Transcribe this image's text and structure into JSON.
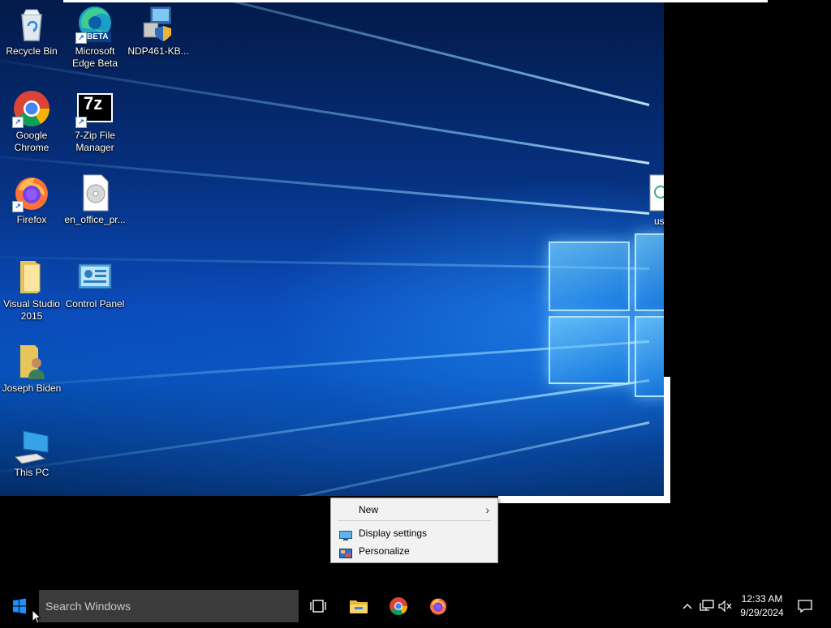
{
  "desktop": {
    "icons": [
      {
        "label": "Recycle Bin",
        "icon": "recycle-bin-icon"
      },
      {
        "label": "Microsoft Edge Beta",
        "icon": "edge-beta-icon",
        "badge": "BETA"
      },
      {
        "label": "NDP461-KB...",
        "icon": "installer-icon"
      },
      {
        "label": "Google Chrome",
        "icon": "chrome-icon"
      },
      {
        "label": "7-Zip File Manager",
        "icon": "7zip-icon",
        "badge": "7z"
      },
      {
        "label": "Firefox",
        "icon": "firefox-icon"
      },
      {
        "label": "en_office_pr...",
        "icon": "disc-image-icon"
      },
      {
        "label": "Visual Studio 2015",
        "icon": "folder-icon"
      },
      {
        "label": "Control Panel",
        "icon": "control-panel-icon"
      },
      {
        "label": "Joseph Biden",
        "icon": "user-folder-icon"
      },
      {
        "label": "This PC",
        "icon": "computer-icon"
      }
    ],
    "partial_icon_label": "us"
  },
  "context_menu": {
    "items": [
      {
        "label": "New",
        "has_submenu": true
      },
      {
        "label": "Display settings",
        "icon": "display-icon"
      },
      {
        "label": "Personalize",
        "icon": "personalize-icon"
      }
    ]
  },
  "taskbar": {
    "search_placeholder": "Search Windows",
    "pinned": [
      "task-view-icon",
      "file-explorer-icon",
      "chrome-icon",
      "firefox-icon"
    ],
    "tray": [
      "chevron-up-icon",
      "network-icon",
      "volume-muted-icon"
    ],
    "clock_time": "12:33 AM",
    "clock_date": "9/29/2024"
  },
  "colors": {
    "taskbar": "#000000",
    "search_box": "#3b3b3b",
    "windows_accent": "#1e90ff"
  }
}
